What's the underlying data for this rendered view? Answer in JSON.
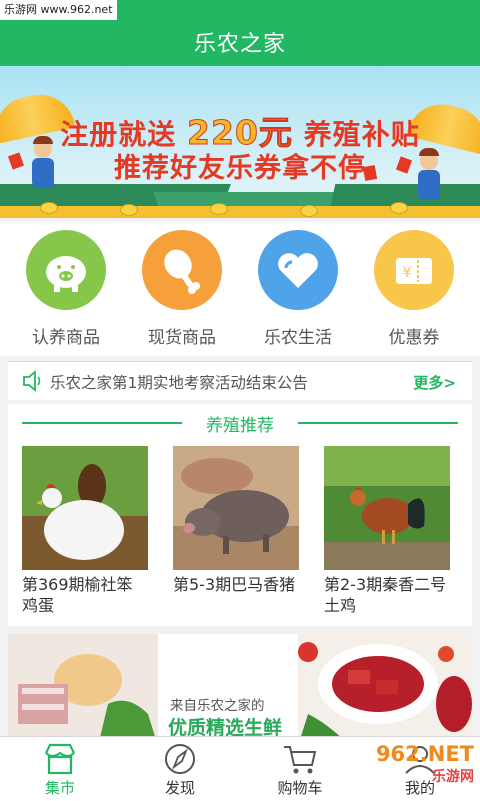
{
  "watermark_top": "乐游网 www.962.net",
  "header": {
    "title": "乐农之家"
  },
  "banner": {
    "line1_a": "注册就送",
    "line1_amount": "220元",
    "line1_b": "养殖补贴",
    "line2": "推荐好友乐券拿不停"
  },
  "categories": [
    {
      "label": "认养商品",
      "icon": "piggy-bank-icon",
      "color": "#86c64a"
    },
    {
      "label": "现货商品",
      "icon": "chicken-leg-icon",
      "color": "#f6a03b"
    },
    {
      "label": "乐农生活",
      "icon": "heart-icon",
      "color": "#4fa3e8"
    },
    {
      "label": "优惠券",
      "icon": "coupon-icon",
      "color": "#f8c64a"
    }
  ],
  "notice": {
    "text": "乐农之家第1期实地考察活动结束公告",
    "more": "更多>"
  },
  "section": {
    "title": "养殖推荐"
  },
  "products": [
    {
      "name": "第369期榆社笨鸡蛋"
    },
    {
      "name": "第5-3期巴马香猪"
    },
    {
      "name": "第2-3期秦香二号土鸡"
    }
  ],
  "promo": {
    "line1": "来自乐农之家的",
    "line2": "优质精选生鲜"
  },
  "tabbar": [
    {
      "label": "集市",
      "icon": "market-icon",
      "active": true
    },
    {
      "label": "发现",
      "icon": "compass-icon",
      "active": false
    },
    {
      "label": "购物车",
      "icon": "cart-icon",
      "active": false
    },
    {
      "label": "我的",
      "icon": "user-icon",
      "active": false
    }
  ],
  "watermark_bottom": {
    "main": "962.NET",
    "sub": "乐游网"
  },
  "colors": {
    "brand": "#22b763",
    "text": "#555555"
  }
}
